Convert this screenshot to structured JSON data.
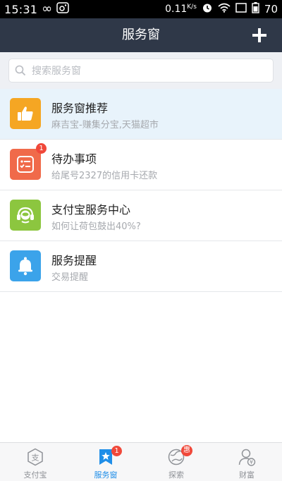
{
  "status_bar": {
    "time": "15:31",
    "speed": "0.11",
    "speed_unit": "K/s",
    "battery": "70"
  },
  "header": {
    "title": "服务窗",
    "add_icon": "plus-icon"
  },
  "search": {
    "placeholder": "搜索服务窗"
  },
  "list": [
    {
      "title": "服务窗推荐",
      "subtitle": "麻吉宝-赚集分宝,天猫超市",
      "icon": "thumbs-up-icon",
      "color": "#f5a623",
      "badge": ""
    },
    {
      "title": "待办事项",
      "subtitle": "给尾号2327的信用卡还款",
      "icon": "checklist-icon",
      "color": "#f06a4a",
      "badge": "1"
    },
    {
      "title": "支付宝服务中心",
      "subtitle": "如何让荷包鼓出40%?",
      "icon": "headset-icon",
      "color": "#8cc63f",
      "badge": ""
    },
    {
      "title": "服务提醒",
      "subtitle": "交易提醒",
      "icon": "bell-icon",
      "color": "#3ba3ea",
      "badge": ""
    }
  ],
  "tabs": [
    {
      "label": "支付宝",
      "icon": "alipay-icon",
      "badge": ""
    },
    {
      "label": "服务窗",
      "icon": "service-window-icon",
      "badge": "1"
    },
    {
      "label": "探索",
      "icon": "explore-icon",
      "badge": "惠"
    },
    {
      "label": "财富",
      "icon": "wealth-icon",
      "badge": ""
    }
  ],
  "colors": {
    "header_bg": "#2f3848",
    "accent": "#1f8ee8",
    "badge": "#f0483a"
  }
}
